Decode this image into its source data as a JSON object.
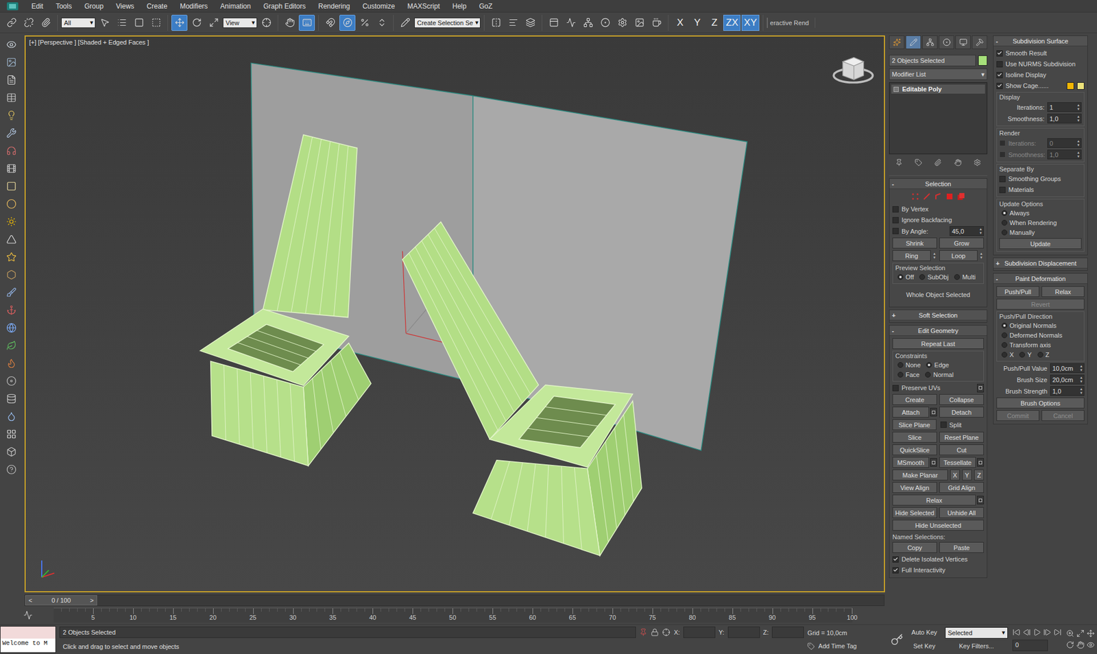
{
  "menu": [
    "Edit",
    "Tools",
    "Group",
    "Views",
    "Create",
    "Modifiers",
    "Animation",
    "Graph Editors",
    "Rendering",
    "Customize",
    "MAXScript",
    "Help",
    "GoZ"
  ],
  "toolbar": [
    [
      {
        "kind": "tool",
        "selected": false
      },
      {
        "kind": "tool",
        "selected": false
      },
      {
        "kind": "tool",
        "selected": false
      }
    ],
    [
      {
        "kind": "dropdown",
        "label": "All"
      },
      {
        "kind": "tool",
        "selected": false
      },
      {
        "kind": "tool",
        "selected": false
      },
      {
        "kind": "tool",
        "selected": false
      },
      {
        "kind": "tool",
        "selected": false
      }
    ],
    [
      {
        "kind": "tool",
        "selected": true
      },
      {
        "kind": "tool",
        "selected": false
      },
      {
        "kind": "tool",
        "selected": false
      },
      {
        "kind": "dropdown",
        "label": "View"
      },
      {
        "kind": "tool",
        "selected": false
      }
    ],
    [
      {
        "kind": "tool",
        "selected": false
      },
      {
        "kind": "tool",
        "selected": true
      }
    ],
    [
      {
        "kind": "tool",
        "selected": false
      },
      {
        "kind": "tool",
        "selected": true
      },
      {
        "kind": "tool",
        "selected": false
      },
      {
        "kind": "tool",
        "selected": false
      }
    ],
    [
      {
        "kind": "tool",
        "selected": false
      },
      {
        "kind": "dropdown",
        "label": "Create Selection Se"
      }
    ],
    [
      {
        "kind": "tool",
        "selected": false
      },
      {
        "kind": "tool",
        "selected": false
      },
      {
        "kind": "tool",
        "selected": false
      }
    ],
    [
      {
        "kind": "tool",
        "selected": false
      },
      {
        "kind": "tool",
        "selected": false
      },
      {
        "kind": "tool",
        "selected": false
      },
      {
        "kind": "tool",
        "selected": false
      },
      {
        "kind": "tool",
        "selected": false
      },
      {
        "kind": "tool",
        "selected": false
      },
      {
        "kind": "tool",
        "selected": false
      }
    ],
    [
      {
        "kind": "axis",
        "label": "X",
        "selected": false
      },
      {
        "kind": "axis",
        "label": "Y",
        "selected": false
      },
      {
        "kind": "axis",
        "label": "Z",
        "selected": false
      },
      {
        "kind": "axis",
        "label": "ZX",
        "selected": true
      },
      {
        "kind": "axis",
        "label": "XY",
        "selected": true
      }
    ],
    [
      {
        "kind": "text",
        "label": "eractive Rend"
      }
    ]
  ],
  "viewport": {
    "label": "[+] [Perspective ] [Shaded + Edged Faces ]"
  },
  "command_panel": {
    "tabs": [
      {
        "selected": false
      },
      {
        "selected": true
      },
      {
        "selected": false
      },
      {
        "selected": false
      },
      {
        "selected": false
      },
      {
        "selected": false
      }
    ],
    "object_name": "2 Objects Selected",
    "object_color": "#a6e07a",
    "modifier_list": "Modifier List",
    "stack": [
      {
        "label": "Editable Poly",
        "selected": true
      }
    ],
    "columns": [
      [
        {
          "title": "Selection",
          "toggle": "-",
          "expanded": true,
          "rows": [
            {
              "kind": "subobject-icons"
            },
            {
              "kind": "check",
              "label": "By Vertex",
              "checked": false
            },
            {
              "kind": "check",
              "label": "Ignore Backfacing",
              "checked": false
            },
            {
              "kind": "check-spin",
              "label": "By Angle:",
              "checked": false,
              "value": "45,0"
            },
            {
              "kind": "buttons",
              "buttons": [
                {
                  "label": "Shrink"
                },
                {
                  "label": "Grow"
                }
              ]
            },
            {
              "kind": "buttons",
              "buttons": [
                {
                  "label": "Ring",
                  "spinner": true
                },
                {
                  "label": "Loop",
                  "spinner": true
                }
              ]
            },
            {
              "kind": "group",
              "label": "Preview Selection",
              "rows": [
                {
                  "kind": "radios",
                  "options": [
                    {
                      "label": "Off",
                      "selected": true
                    },
                    {
                      "label": "SubObj",
                      "selected": false
                    },
                    {
                      "label": "Multi",
                      "selected": false
                    }
                  ]
                }
              ]
            },
            {
              "kind": "text",
              "label": "Whole Object Selected"
            }
          ]
        },
        {
          "title": "Soft Selection",
          "toggle": "+",
          "expanded": false,
          "rows": []
        },
        {
          "title": "Edit Geometry",
          "toggle": "-",
          "expanded": true,
          "rows": [
            {
              "kind": "buttons",
              "buttons": [
                {
                  "label": "Repeat Last"
                }
              ]
            },
            {
              "kind": "group",
              "label": "Constraints",
              "rows": [
                {
                  "kind": "radios",
                  "options": [
                    {
                      "label": "None",
                      "selected": false
                    },
                    {
                      "label": "Edge",
                      "selected": true
                    }
                  ]
                },
                {
                  "kind": "radios",
                  "options": [
                    {
                      "label": "Face",
                      "selected": false
                    },
                    {
                      "label": "Normal",
                      "selected": false
                    }
                  ]
                }
              ]
            },
            {
              "kind": "check",
              "label": "Preserve UVs",
              "checked": false,
              "settings": true
            },
            {
              "kind": "buttons",
              "buttons": [
                {
                  "label": "Create"
                },
                {
                  "label": "Collapse"
                }
              ]
            },
            {
              "kind": "buttons",
              "buttons": [
                {
                  "label": "Attach",
                  "settings": true
                },
                {
                  "label": "Detach"
                }
              ]
            },
            {
              "kind": "buttons",
              "buttons": [
                {
                  "label": "Slice Plane"
                },
                {
                  "kind": "check",
                  "label": "Split",
                  "checked": false
                }
              ]
            },
            {
              "kind": "buttons",
              "buttons": [
                {
                  "label": "Slice"
                },
                {
                  "label": "Reset Plane"
                }
              ]
            },
            {
              "kind": "buttons",
              "buttons": [
                {
                  "label": "QuickSlice"
                },
                {
                  "label": "Cut"
                }
              ]
            },
            {
              "kind": "buttons",
              "buttons": [
                {
                  "label": "MSmooth",
                  "settings": true
                },
                {
                  "label": "Tessellate",
                  "settings": true
                }
              ]
            },
            {
              "kind": "buttons",
              "buttons": [
                {
                  "label": "Make Planar"
                },
                {
                  "label": "X"
                },
                {
                  "label": "Y"
                },
                {
                  "label": "Z"
                }
              ]
            },
            {
              "kind": "buttons",
              "buttons": [
                {
                  "label": "View Align"
                },
                {
                  "label": "Grid Align"
                }
              ]
            },
            {
              "kind": "buttons",
              "buttons": [
                {
                  "label": "Relax",
                  "settings": true
                }
              ]
            },
            {
              "kind": "buttons",
              "buttons": [
                {
                  "label": "Hide Selected"
                },
                {
                  "label": "Unhide All"
                }
              ]
            },
            {
              "kind": "buttons",
              "buttons": [
                {
                  "label": "Hide Unselected"
                }
              ]
            },
            {
              "kind": "heading",
              "label": "Named Selections:"
            },
            {
              "kind": "buttons",
              "buttons": [
                {
                  "label": "Copy"
                },
                {
                  "label": "Paste"
                }
              ]
            },
            {
              "kind": "check",
              "label": "Delete Isolated Vertices",
              "checked": true
            },
            {
              "kind": "check",
              "label": "Full Interactivity",
              "checked": true
            }
          ]
        }
      ],
      [
        {
          "title": "Subdivision Surface",
          "toggle": "-",
          "expanded": true,
          "rows": [
            {
              "kind": "check",
              "label": "Smooth Result",
              "checked": true
            },
            {
              "kind": "check",
              "label": "Use NURMS Subdivision",
              "checked": false
            },
            {
              "kind": "check",
              "label": "Isoline Display",
              "checked": true
            },
            {
              "kind": "check",
              "label": "Show Cage......",
              "checked": true,
              "colors": [
                "#f2b705",
                "#ece27a"
              ]
            },
            {
              "kind": "group",
              "label": "Display",
              "rows": [
                {
                  "kind": "spin",
                  "label": "Iterations:",
                  "value": "1"
                },
                {
                  "kind": "spin",
                  "label": "Smoothness:",
                  "value": "1,0"
                }
              ]
            },
            {
              "kind": "group",
              "label": "Render",
              "rows": [
                {
                  "kind": "check-spin",
                  "label": "Iterations:",
                  "checked": false,
                  "value": "0",
                  "disabled": true
                },
                {
                  "kind": "check-spin",
                  "label": "Smoothness:",
                  "checked": false,
                  "value": "1,0",
                  "disabled": true
                }
              ]
            },
            {
              "kind": "group",
              "label": "Separate By",
              "rows": [
                {
                  "kind": "check",
                  "label": "Smoothing Groups",
                  "checked": false
                },
                {
                  "kind": "check",
                  "label": "Materials",
                  "checked": false
                }
              ]
            },
            {
              "kind": "group",
              "label": "Update Options",
              "rows": [
                {
                  "kind": "radio-list",
                  "options": [
                    {
                      "label": "Always",
                      "selected": true
                    },
                    {
                      "label": "When Rendering",
                      "selected": false
                    },
                    {
                      "label": "Manually",
                      "selected": false
                    }
                  ]
                },
                {
                  "kind": "buttons",
                  "buttons": [
                    {
                      "label": "Update"
                    }
                  ]
                }
              ]
            }
          ]
        },
        {
          "title": "Subdivision Displacement",
          "toggle": "+",
          "expanded": false,
          "rows": []
        },
        {
          "title": "Paint Deformation",
          "toggle": "-",
          "expanded": true,
          "rows": [
            {
              "kind": "buttons",
              "buttons": [
                {
                  "label": "Push/Pull"
                },
                {
                  "label": "Relax"
                }
              ]
            },
            {
              "kind": "buttons",
              "buttons": [
                {
                  "label": "Revert",
                  "disabled": true
                }
              ]
            },
            {
              "kind": "group",
              "label": "Push/Pull Direction",
              "rows": [
                {
                  "kind": "radio-list",
                  "options": [
                    {
                      "label": "Original Normals",
                      "selected": true
                    },
                    {
                      "label": "Deformed Normals",
                      "selected": false
                    },
                    {
                      "label": "Transform axis",
                      "selected": false
                    }
                  ]
                },
                {
                  "kind": "radios",
                  "options": [
                    {
                      "label": "X",
                      "selected": false
                    },
                    {
                      "label": "Y",
                      "selected": false
                    },
                    {
                      "label": "Z",
                      "selected": false
                    }
                  ]
                }
              ]
            },
            {
              "kind": "spin",
              "label": "Push/Pull Value",
              "value": "10,0cm"
            },
            {
              "kind": "spin",
              "label": "Brush Size",
              "value": "20,0cm"
            },
            {
              "kind": "spin",
              "label": "Brush Strength",
              "value": "1,0"
            },
            {
              "kind": "buttons",
              "buttons": [
                {
                  "label": "Brush Options"
                }
              ]
            },
            {
              "kind": "buttons",
              "buttons": [
                {
                  "label": "Commit",
                  "disabled": true
                },
                {
                  "label": "Cancel",
                  "disabled": true
                }
              ]
            }
          ]
        }
      ]
    ]
  },
  "timeline": {
    "position": "0 / 100",
    "prev": "<",
    "next": ">",
    "level": 0,
    "ticks": [
      "5",
      "10",
      "15",
      "20",
      "25",
      "30",
      "35",
      "40",
      "45",
      "50",
      "55",
      "60",
      "65",
      "70",
      "75",
      "80",
      "85",
      "90",
      "95",
      "100"
    ]
  },
  "status_bar": {
    "listener": "Welcome to M",
    "selection": "2 Objects Selected",
    "prompt": "Click and drag to select and move objects",
    "coords": [
      {
        "label": "X:",
        "value": ""
      },
      {
        "label": "Y:",
        "value": ""
      },
      {
        "label": "Z:",
        "value": ""
      }
    ],
    "grid": "Grid = 10,0cm",
    "time_tag": "Add Time Tag",
    "auto_key": "Auto Key",
    "key_mode": "Selected",
    "set_key": "Set Key",
    "key_filters": "Key Filters...",
    "frame": "0"
  }
}
